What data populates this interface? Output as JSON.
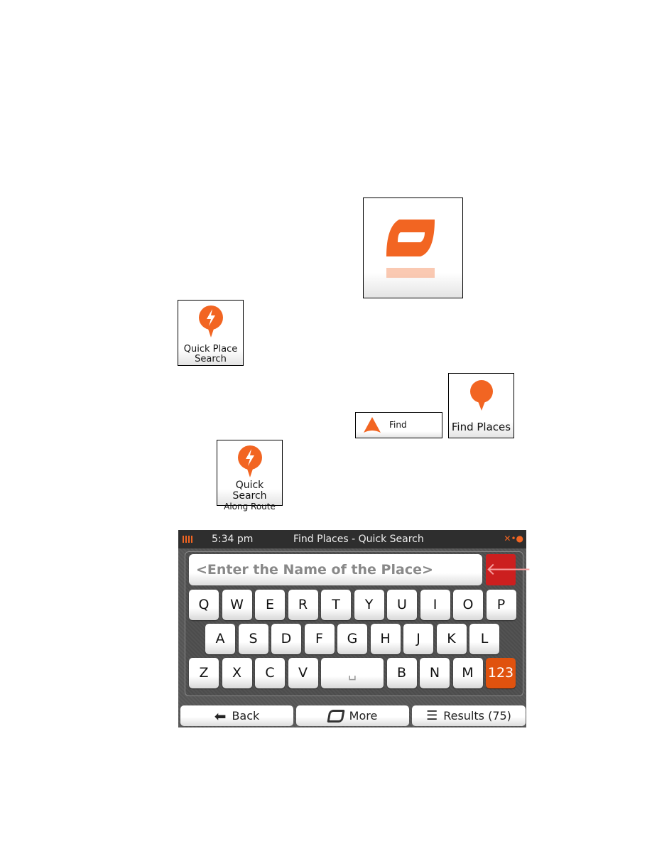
{
  "icons": {
    "more_large": {
      "name": "more-icon"
    },
    "quick_place_search": {
      "label_line1": "Quick Place",
      "label_line2": "Search"
    },
    "find": {
      "label": "Find"
    },
    "find_places": {
      "label": "Find Places"
    },
    "quick_search_along_route": {
      "label_line1": "Quick Search",
      "label_line2": "Along Route"
    }
  },
  "device": {
    "time": "5:34 pm",
    "title": "Find Places - Quick Search",
    "input_placeholder": "<Enter the Name of the Place>",
    "rows": [
      [
        "Q",
        "W",
        "E",
        "R",
        "T",
        "Y",
        "U",
        "I",
        "O",
        "P"
      ],
      [
        "A",
        "S",
        "D",
        "F",
        "G",
        "H",
        "J",
        "K",
        "L"
      ],
      [
        "Z",
        "X",
        "C",
        "V",
        "␣",
        "B",
        "N",
        "M",
        "123"
      ]
    ],
    "back": "Back",
    "more": "More",
    "results": "Results (75)",
    "colors": {
      "accent": "#f26522",
      "delete": "#cc1f1f",
      "numeric_key": "#e0520e"
    }
  }
}
